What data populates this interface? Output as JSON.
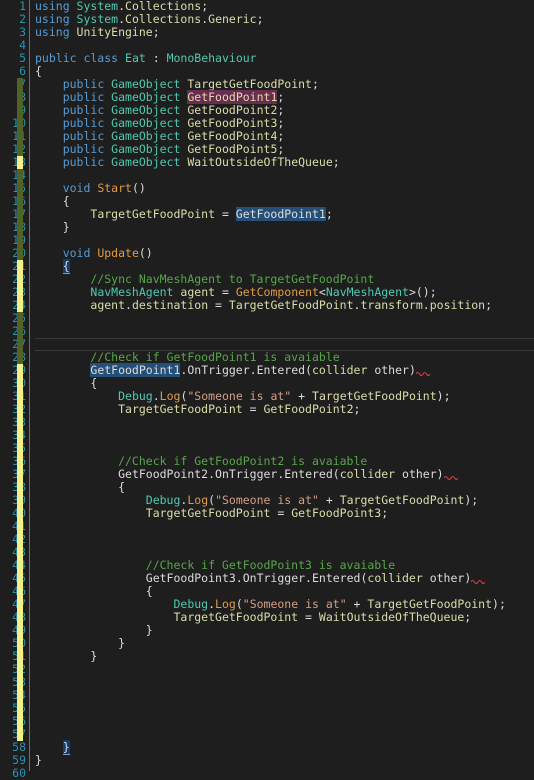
{
  "editor": {
    "language": "csharp",
    "theme": "dark",
    "total_lines": 60,
    "current_line": 27,
    "colors": {
      "background": "#1e1e1e",
      "line_number": "#2b91af",
      "keyword": "#569cd6",
      "type": "#4ec9b0",
      "identifier": "#dcdcaa",
      "method": "#e09b47",
      "comment": "#57a64a",
      "string": "#d69d85",
      "punctuation": "#dcdcdc",
      "reference_highlight": "#264f78",
      "rename_highlight": "#6b2d4f",
      "brace_match": "#143d69",
      "change_bar_saved": "#4f6228",
      "change_bar_unsaved": "#f0f08a",
      "error_squiggle": "#d84040"
    }
  },
  "change_bar": [
    {
      "from_line": 7,
      "to_line": 12,
      "state": "saved",
      "color": "#4f6228"
    },
    {
      "from_line": 13,
      "to_line": 13,
      "state": "unsaved",
      "color": "#f0f08a"
    },
    {
      "from_line": 14,
      "to_line": 20,
      "state": "saved",
      "color": "#4f6228"
    },
    {
      "from_line": 21,
      "to_line": 24,
      "state": "unsaved",
      "color": "#f0f08a"
    },
    {
      "from_line": 25,
      "to_line": 28,
      "state": "saved",
      "color": "#4f6228"
    },
    {
      "from_line": 29,
      "to_line": 57,
      "state": "unsaved",
      "color": "#f0f08a"
    }
  ],
  "line_numbers": [
    1,
    2,
    3,
    4,
    5,
    6,
    7,
    8,
    9,
    10,
    11,
    12,
    13,
    14,
    15,
    16,
    17,
    18,
    19,
    20,
    21,
    22,
    23,
    24,
    25,
    26,
    27,
    28,
    29,
    30,
    31,
    32,
    33,
    34,
    35,
    36,
    37,
    38,
    39,
    40,
    41,
    42,
    43,
    44,
    45,
    46,
    47,
    48,
    49,
    50,
    51,
    52,
    53,
    54,
    55,
    56,
    57,
    58,
    59,
    60
  ],
  "code_lines": [
    {
      "n": 1,
      "tokens": [
        {
          "t": "using ",
          "c": "k"
        },
        {
          "t": "System",
          "c": "ty"
        },
        {
          "t": ".",
          "c": "p"
        },
        {
          "t": "Collections",
          "c": "id"
        },
        {
          "t": ";",
          "c": "p"
        }
      ]
    },
    {
      "n": 2,
      "tokens": [
        {
          "t": "using ",
          "c": "k"
        },
        {
          "t": "System",
          "c": "ty"
        },
        {
          "t": ".",
          "c": "p"
        },
        {
          "t": "Collections",
          "c": "id"
        },
        {
          "t": ".",
          "c": "p"
        },
        {
          "t": "Generic",
          "c": "id"
        },
        {
          "t": ";",
          "c": "p"
        }
      ]
    },
    {
      "n": 3,
      "tokens": [
        {
          "t": "using ",
          "c": "k"
        },
        {
          "t": "UnityEngine",
          "c": "id"
        },
        {
          "t": ";",
          "c": "p"
        }
      ]
    },
    {
      "n": 4,
      "tokens": []
    },
    {
      "n": 5,
      "tokens": [
        {
          "t": "public class ",
          "c": "k"
        },
        {
          "t": "Eat",
          "c": "ty"
        },
        {
          "t": " : ",
          "c": "p"
        },
        {
          "t": "MonoBehaviour",
          "c": "ty"
        }
      ]
    },
    {
      "n": 6,
      "tokens": [
        {
          "t": "{",
          "c": "p"
        }
      ]
    },
    {
      "n": 7,
      "tokens": [
        {
          "t": "    ",
          "c": "p"
        },
        {
          "t": "public ",
          "c": "k"
        },
        {
          "t": "GameObject",
          "c": "ty"
        },
        {
          "t": " ",
          "c": "p"
        },
        {
          "t": "TargetGetFoodPoint",
          "c": "id"
        },
        {
          "t": ";",
          "c": "p"
        }
      ]
    },
    {
      "n": 8,
      "tokens": [
        {
          "t": "    ",
          "c": "p"
        },
        {
          "t": "public ",
          "c": "k"
        },
        {
          "t": "GameObject",
          "c": "ty"
        },
        {
          "t": " ",
          "c": "p"
        },
        {
          "t": "GetFoodPoint1",
          "c": "renamehl"
        },
        {
          "t": ";",
          "c": "p"
        }
      ]
    },
    {
      "n": 9,
      "tokens": [
        {
          "t": "    ",
          "c": "p"
        },
        {
          "t": "public ",
          "c": "k"
        },
        {
          "t": "GameObject",
          "c": "ty"
        },
        {
          "t": " ",
          "c": "p"
        },
        {
          "t": "GetFoodPoint2",
          "c": "id"
        },
        {
          "t": ";",
          "c": "p"
        }
      ]
    },
    {
      "n": 10,
      "tokens": [
        {
          "t": "    ",
          "c": "p"
        },
        {
          "t": "public ",
          "c": "k"
        },
        {
          "t": "GameObject",
          "c": "ty"
        },
        {
          "t": " ",
          "c": "p"
        },
        {
          "t": "GetFoodPoint3",
          "c": "id"
        },
        {
          "t": ";",
          "c": "p"
        }
      ]
    },
    {
      "n": 11,
      "tokens": [
        {
          "t": "    ",
          "c": "p"
        },
        {
          "t": "public ",
          "c": "k"
        },
        {
          "t": "GameObject",
          "c": "ty"
        },
        {
          "t": " ",
          "c": "p"
        },
        {
          "t": "GetFoodPoint4",
          "c": "id"
        },
        {
          "t": ";",
          "c": "p"
        }
      ]
    },
    {
      "n": 12,
      "tokens": [
        {
          "t": "    ",
          "c": "p"
        },
        {
          "t": "public ",
          "c": "k"
        },
        {
          "t": "GameObject",
          "c": "ty"
        },
        {
          "t": " ",
          "c": "p"
        },
        {
          "t": "GetFoodPoint5",
          "c": "id"
        },
        {
          "t": ";",
          "c": "p"
        }
      ]
    },
    {
      "n": 13,
      "tokens": [
        {
          "t": "    ",
          "c": "p"
        },
        {
          "t": "public ",
          "c": "k"
        },
        {
          "t": "GameObject",
          "c": "ty"
        },
        {
          "t": " ",
          "c": "p"
        },
        {
          "t": "WaitOutsideOfTheQueue",
          "c": "id"
        },
        {
          "t": ";",
          "c": "p"
        }
      ]
    },
    {
      "n": 14,
      "tokens": []
    },
    {
      "n": 15,
      "tokens": [
        {
          "t": "    ",
          "c": "p"
        },
        {
          "t": "void ",
          "c": "k"
        },
        {
          "t": "Start",
          "c": "meth"
        },
        {
          "t": "()",
          "c": "p"
        }
      ]
    },
    {
      "n": 16,
      "tokens": [
        {
          "t": "    {",
          "c": "p"
        }
      ]
    },
    {
      "n": 17,
      "tokens": [
        {
          "t": "        ",
          "c": "p"
        },
        {
          "t": "TargetGetFoodPoint",
          "c": "id"
        },
        {
          "t": " = ",
          "c": "p"
        },
        {
          "t": "GetFoodPoint1",
          "c": "refhl"
        },
        {
          "t": ";",
          "c": "p"
        }
      ]
    },
    {
      "n": 18,
      "tokens": [
        {
          "t": "    }",
          "c": "p"
        }
      ]
    },
    {
      "n": 19,
      "tokens": []
    },
    {
      "n": 20,
      "tokens": [
        {
          "t": "    ",
          "c": "p"
        },
        {
          "t": "void ",
          "c": "k"
        },
        {
          "t": "Update",
          "c": "meth"
        },
        {
          "t": "()",
          "c": "p"
        }
      ]
    },
    {
      "n": 21,
      "tokens": [
        {
          "t": "    ",
          "c": "p"
        },
        {
          "t": "{",
          "c": "brace"
        }
      ]
    },
    {
      "n": 22,
      "tokens": [
        {
          "t": "        //Sync NavMeshAgent to TargetGetFoodPoint",
          "c": "cm"
        }
      ]
    },
    {
      "n": 23,
      "tokens": [
        {
          "t": "        ",
          "c": "p"
        },
        {
          "t": "NavMeshAgent",
          "c": "ty"
        },
        {
          "t": " ",
          "c": "p"
        },
        {
          "t": "agent",
          "c": "id"
        },
        {
          "t": " = ",
          "c": "p"
        },
        {
          "t": "GetComponent",
          "c": "meth"
        },
        {
          "t": "<",
          "c": "p"
        },
        {
          "t": "NavMeshAgent",
          "c": "ty"
        },
        {
          "t": ">();",
          "c": "p"
        }
      ]
    },
    {
      "n": 24,
      "tokens": [
        {
          "t": "        ",
          "c": "p"
        },
        {
          "t": "agent",
          "c": "id"
        },
        {
          "t": ".",
          "c": "p"
        },
        {
          "t": "destination",
          "c": "id"
        },
        {
          "t": " = ",
          "c": "p"
        },
        {
          "t": "TargetGetFoodPoint",
          "c": "id"
        },
        {
          "t": ".",
          "c": "p"
        },
        {
          "t": "transform",
          "c": "id"
        },
        {
          "t": ".",
          "c": "p"
        },
        {
          "t": "position",
          "c": "id"
        },
        {
          "t": ";",
          "c": "p"
        }
      ]
    },
    {
      "n": 25,
      "tokens": []
    },
    {
      "n": 26,
      "tokens": []
    },
    {
      "n": 27,
      "tokens": [],
      "current": true
    },
    {
      "n": 28,
      "tokens": [
        {
          "t": "        //Check if GetFoodPoint1 is avaiable",
          "c": "cm"
        }
      ]
    },
    {
      "n": 29,
      "tokens": [
        {
          "t": "        ",
          "c": "p"
        },
        {
          "t": "GetFoodPoint1",
          "c": "refhl"
        },
        {
          "t": ".",
          "c": "p"
        },
        {
          "t": "OnTrigger",
          "c": "p"
        },
        {
          "t": ".",
          "c": "p"
        },
        {
          "t": "Entered",
          "c": "p"
        },
        {
          "t": "(",
          "c": "p"
        },
        {
          "t": "collider",
          "c": "id"
        },
        {
          "t": " other",
          "c": "p"
        },
        {
          "t": ")",
          "c": "p"
        }
      ],
      "squiggle": true
    },
    {
      "n": 30,
      "tokens": [
        {
          "t": "        {",
          "c": "p"
        }
      ]
    },
    {
      "n": 31,
      "tokens": [
        {
          "t": "            ",
          "c": "p"
        },
        {
          "t": "Debug",
          "c": "ty"
        },
        {
          "t": ".",
          "c": "p"
        },
        {
          "t": "Log",
          "c": "meth"
        },
        {
          "t": "(",
          "c": "p"
        },
        {
          "t": "\"Someone is at\"",
          "c": "st"
        },
        {
          "t": " + ",
          "c": "p"
        },
        {
          "t": "TargetGetFoodPoint",
          "c": "id"
        },
        {
          "t": ");",
          "c": "p"
        }
      ]
    },
    {
      "n": 32,
      "tokens": [
        {
          "t": "            ",
          "c": "p"
        },
        {
          "t": "TargetGetFoodPoint",
          "c": "id"
        },
        {
          "t": " = ",
          "c": "p"
        },
        {
          "t": "GetFoodPoint2",
          "c": "id"
        },
        {
          "t": ";",
          "c": "p"
        }
      ]
    },
    {
      "n": 33,
      "tokens": []
    },
    {
      "n": 34,
      "tokens": []
    },
    {
      "n": 35,
      "tokens": []
    },
    {
      "n": 36,
      "tokens": [
        {
          "t": "            //Check if GetFoodPoint2 is avaiable",
          "c": "cm"
        }
      ]
    },
    {
      "n": 37,
      "tokens": [
        {
          "t": "            ",
          "c": "p"
        },
        {
          "t": "GetFoodPoint2",
          "c": "p"
        },
        {
          "t": ".",
          "c": "p"
        },
        {
          "t": "OnTrigger",
          "c": "p"
        },
        {
          "t": ".",
          "c": "p"
        },
        {
          "t": "Entered",
          "c": "p"
        },
        {
          "t": "(",
          "c": "p"
        },
        {
          "t": "collider",
          "c": "id"
        },
        {
          "t": " other",
          "c": "p"
        },
        {
          "t": ")",
          "c": "p"
        }
      ],
      "squiggle": true
    },
    {
      "n": 38,
      "tokens": [
        {
          "t": "            {",
          "c": "p"
        }
      ]
    },
    {
      "n": 39,
      "tokens": [
        {
          "t": "                ",
          "c": "p"
        },
        {
          "t": "Debug",
          "c": "ty"
        },
        {
          "t": ".",
          "c": "p"
        },
        {
          "t": "Log",
          "c": "meth"
        },
        {
          "t": "(",
          "c": "p"
        },
        {
          "t": "\"Someone is at\"",
          "c": "st"
        },
        {
          "t": " + ",
          "c": "p"
        },
        {
          "t": "TargetGetFoodPoint",
          "c": "id"
        },
        {
          "t": ");",
          "c": "p"
        }
      ]
    },
    {
      "n": 40,
      "tokens": [
        {
          "t": "                ",
          "c": "p"
        },
        {
          "t": "TargetGetFoodPoint",
          "c": "id"
        },
        {
          "t": " = ",
          "c": "p"
        },
        {
          "t": "GetFoodPoint3",
          "c": "id"
        },
        {
          "t": ";",
          "c": "p"
        }
      ]
    },
    {
      "n": 41,
      "tokens": []
    },
    {
      "n": 42,
      "tokens": []
    },
    {
      "n": 43,
      "tokens": []
    },
    {
      "n": 44,
      "tokens": [
        {
          "t": "                //Check if GetFoodPoint3 is avaiable",
          "c": "cm"
        }
      ]
    },
    {
      "n": 45,
      "tokens": [
        {
          "t": "                ",
          "c": "p"
        },
        {
          "t": "GetFoodPoint3",
          "c": "p"
        },
        {
          "t": ".",
          "c": "p"
        },
        {
          "t": "OnTrigger",
          "c": "p"
        },
        {
          "t": ".",
          "c": "p"
        },
        {
          "t": "Entered",
          "c": "p"
        },
        {
          "t": "(",
          "c": "p"
        },
        {
          "t": "collider",
          "c": "id"
        },
        {
          "t": " other",
          "c": "p"
        },
        {
          "t": ")",
          "c": "p"
        }
      ],
      "squiggle": true
    },
    {
      "n": 46,
      "tokens": [
        {
          "t": "                {",
          "c": "p"
        }
      ]
    },
    {
      "n": 47,
      "tokens": [
        {
          "t": "                    ",
          "c": "p"
        },
        {
          "t": "Debug",
          "c": "ty"
        },
        {
          "t": ".",
          "c": "p"
        },
        {
          "t": "Log",
          "c": "meth"
        },
        {
          "t": "(",
          "c": "p"
        },
        {
          "t": "\"Someone is at\"",
          "c": "st"
        },
        {
          "t": " + ",
          "c": "p"
        },
        {
          "t": "TargetGetFoodPoint",
          "c": "id"
        },
        {
          "t": ");",
          "c": "p"
        }
      ]
    },
    {
      "n": 48,
      "tokens": [
        {
          "t": "                    ",
          "c": "p"
        },
        {
          "t": "TargetGetFoodPoint",
          "c": "id"
        },
        {
          "t": " = ",
          "c": "p"
        },
        {
          "t": "WaitOutsideOfTheQueue",
          "c": "id"
        },
        {
          "t": ";",
          "c": "p"
        }
      ]
    },
    {
      "n": 49,
      "tokens": [
        {
          "t": "                }",
          "c": "p"
        }
      ]
    },
    {
      "n": 50,
      "tokens": [
        {
          "t": "            }",
          "c": "p"
        }
      ]
    },
    {
      "n": 51,
      "tokens": [
        {
          "t": "        }",
          "c": "p"
        }
      ]
    },
    {
      "n": 52,
      "tokens": []
    },
    {
      "n": 53,
      "tokens": []
    },
    {
      "n": 54,
      "tokens": []
    },
    {
      "n": 55,
      "tokens": []
    },
    {
      "n": 56,
      "tokens": []
    },
    {
      "n": 57,
      "tokens": []
    },
    {
      "n": 58,
      "tokens": [
        {
          "t": "    ",
          "c": "p"
        },
        {
          "t": "}",
          "c": "brace"
        }
      ]
    },
    {
      "n": 59,
      "tokens": [
        {
          "t": "}",
          "c": "p"
        }
      ]
    },
    {
      "n": 60,
      "tokens": []
    }
  ]
}
